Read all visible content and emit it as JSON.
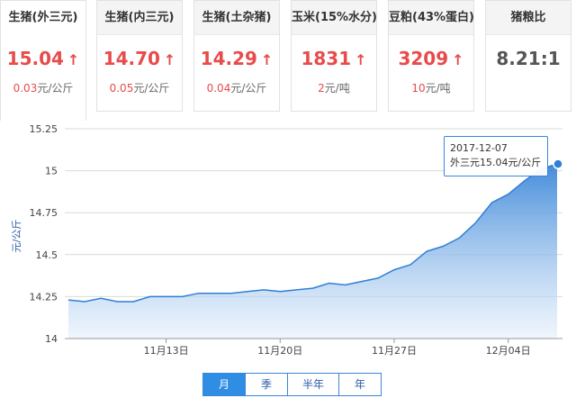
{
  "cards": [
    {
      "title": "生猪(外三元)",
      "value": "15.04",
      "arrow": "↑",
      "change_num": "0.03",
      "change_unit": "元/公斤",
      "active": true
    },
    {
      "title": "生猪(内三元)",
      "value": "14.70",
      "arrow": "↑",
      "change_num": "0.05",
      "change_unit": "元/公斤",
      "active": false
    },
    {
      "title": "生猪(土杂猪)",
      "value": "14.29",
      "arrow": "↑",
      "change_num": "0.04",
      "change_unit": "元/公斤",
      "active": false
    },
    {
      "title": "玉米(15%水分)",
      "value": "1831",
      "arrow": "↑",
      "change_num": "2",
      "change_unit": "元/吨",
      "active": false
    },
    {
      "title": "豆粕(43%蛋白)",
      "value": "3209",
      "arrow": "↑",
      "change_num": "10",
      "change_unit": "元/吨",
      "active": false
    },
    {
      "title": "猪粮比",
      "value": "8.21:1",
      "arrow": "",
      "change_num": "",
      "change_unit": "",
      "active": false
    }
  ],
  "colors": {
    "up": "#e84b4b",
    "line": "#2f7fd6",
    "area_top": "#3a86d9",
    "area_bottom": "#e4effb",
    "grid": "#d9d9d9"
  },
  "chart_data": {
    "type": "area",
    "ylabel": "元/公斤",
    "ylim": [
      14,
      15.25
    ],
    "yticks": [
      "15.25",
      "15",
      "14.75",
      "14.5",
      "14.25",
      "14"
    ],
    "xticks": [
      "11月13日",
      "11月20日",
      "11月27日",
      "12月04日"
    ],
    "grid": true,
    "x": [
      "11-07",
      "11-08",
      "11-09",
      "11-10",
      "11-11",
      "11-12",
      "11-13",
      "11-14",
      "11-15",
      "11-16",
      "11-17",
      "11-18",
      "11-19",
      "11-20",
      "11-21",
      "11-22",
      "11-23",
      "11-24",
      "11-25",
      "11-26",
      "11-27",
      "11-28",
      "11-29",
      "11-30",
      "12-01",
      "12-02",
      "12-03",
      "12-04",
      "12-05",
      "12-06",
      "12-07"
    ],
    "values": [
      14.23,
      14.22,
      14.24,
      14.22,
      14.22,
      14.25,
      14.25,
      14.25,
      14.27,
      14.27,
      14.27,
      14.28,
      14.29,
      14.28,
      14.29,
      14.3,
      14.33,
      14.32,
      14.34,
      14.36,
      14.41,
      14.44,
      14.52,
      14.55,
      14.6,
      14.69,
      14.81,
      14.86,
      14.94,
      15.01,
      15.04
    ],
    "tooltip": {
      "date": "2017-12-07",
      "text": "外三元15.04元/公斤"
    }
  },
  "range_buttons": [
    {
      "label": "月",
      "active": true
    },
    {
      "label": "季",
      "active": false
    },
    {
      "label": "半年",
      "active": false
    },
    {
      "label": "年",
      "active": false
    }
  ]
}
